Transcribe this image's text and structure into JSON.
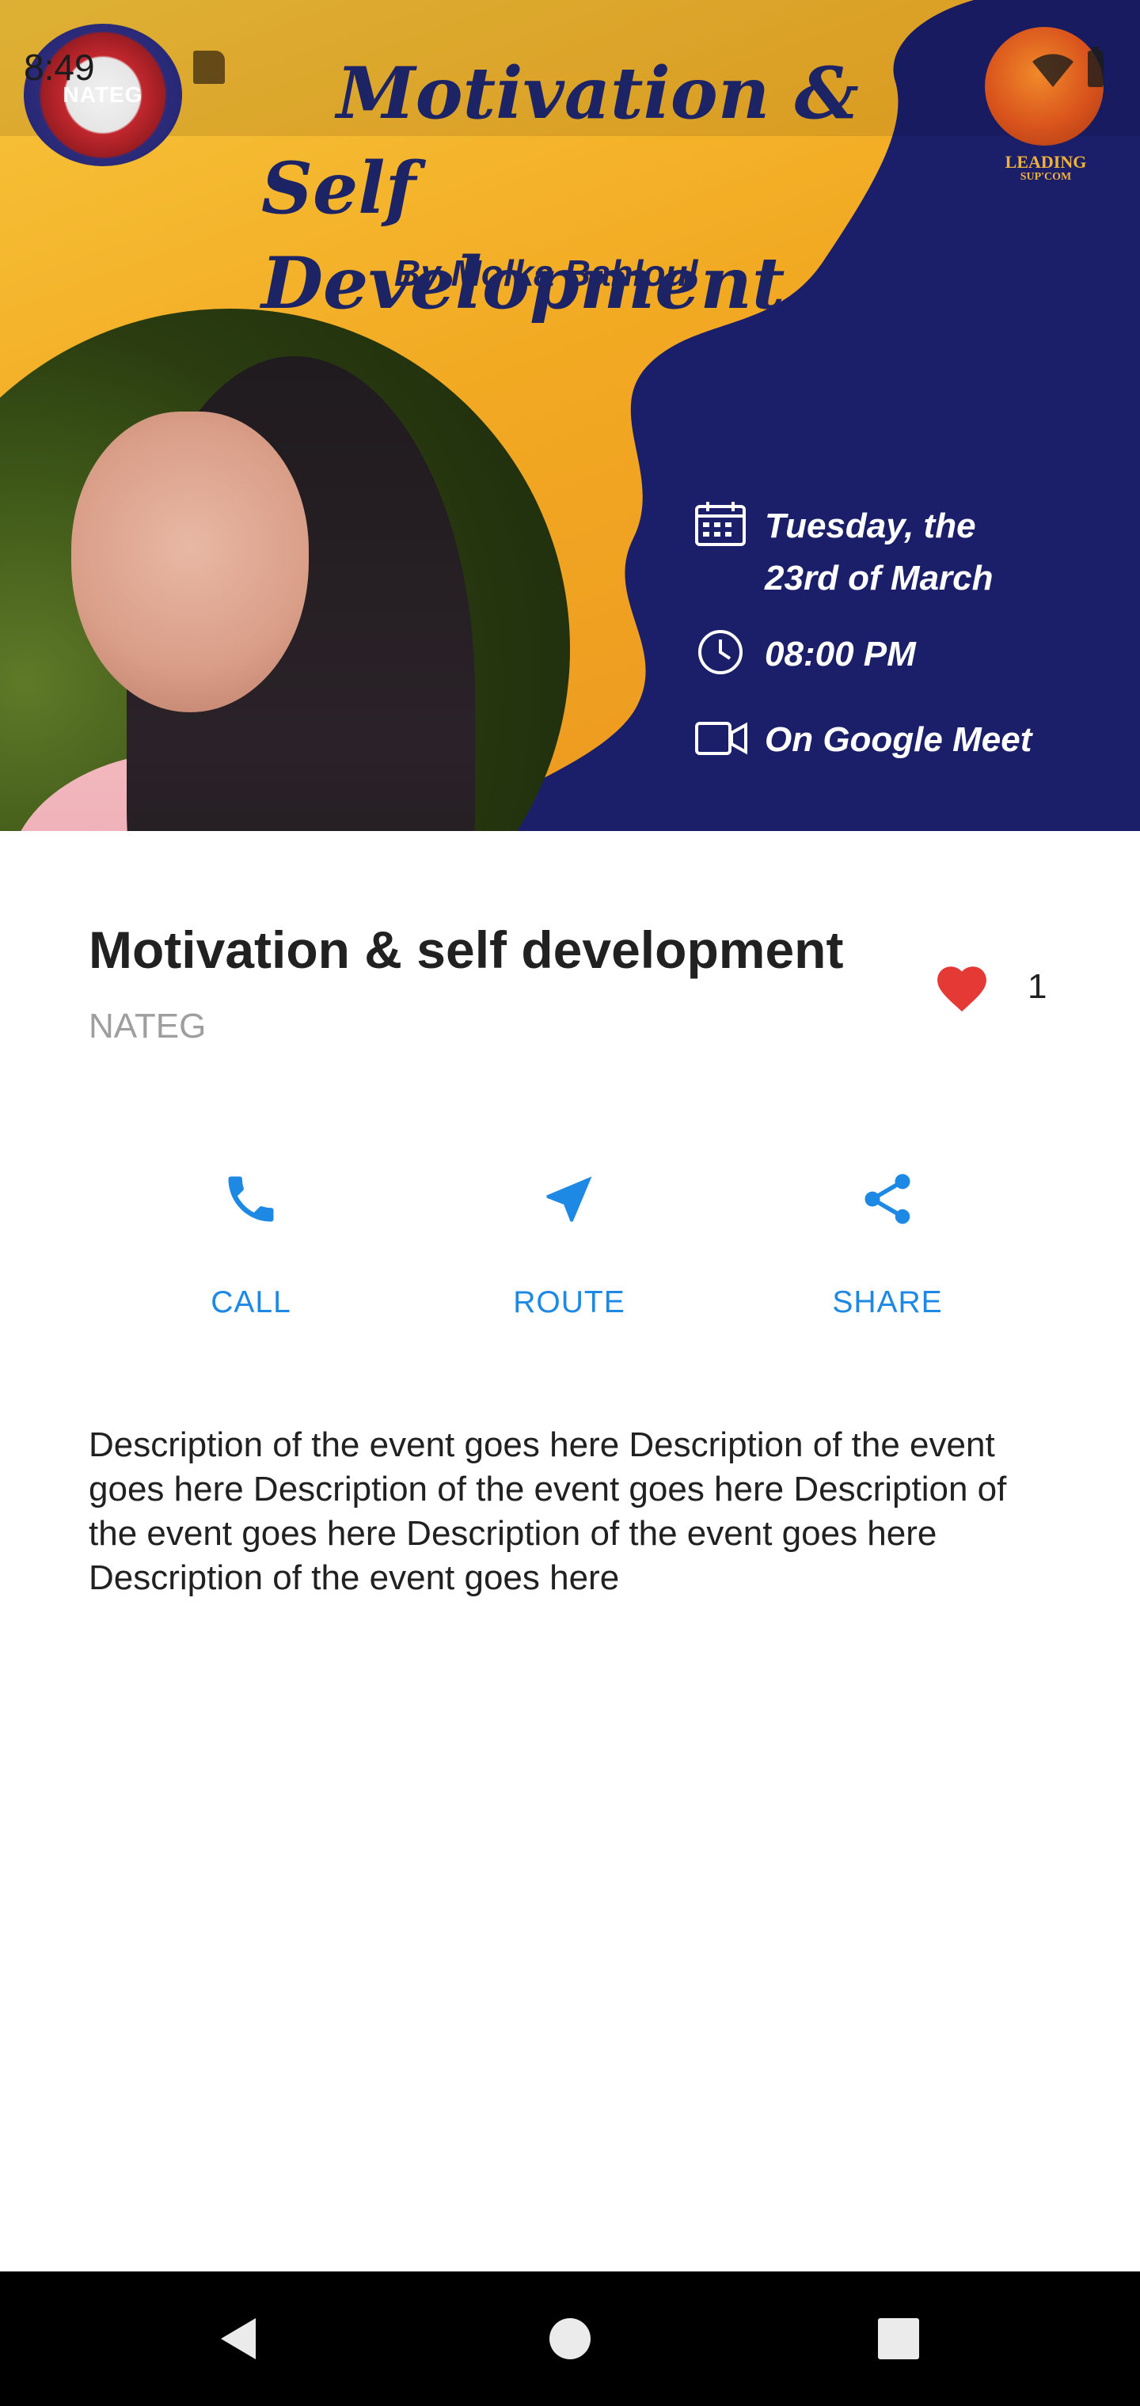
{
  "status_bar": {
    "time": "8:49",
    "icons": [
      "sd-card-icon",
      "wifi-icon",
      "battery-icon"
    ]
  },
  "banner": {
    "logo_left_text": "NATEG",
    "logo_right_text": "LEADING",
    "logo_right_subtext": "SUP'COM",
    "title_line1": "Motivation &",
    "title_line2": "Self Development",
    "byline": "By Molka Bahloul",
    "date_line1": "Tuesday, the",
    "date_line2": "23rd of March",
    "time": "08:00 PM",
    "platform": "On Google Meet",
    "colors": {
      "yellow": "#f2a922",
      "navy": "#1b1f6a"
    }
  },
  "event": {
    "title": "Motivation & self development",
    "organizer": "NATEG",
    "likes": "1"
  },
  "actions": [
    {
      "label": "CALL",
      "icon": "phone-icon"
    },
    {
      "label": "ROUTE",
      "icon": "navigation-arrow-icon"
    },
    {
      "label": "SHARE",
      "icon": "share-icon"
    }
  ],
  "description": "Description of the event goes here Description of the event goes here Description of the event goes here Description of the event goes here Description of the event goes here Description of the event goes here",
  "nav_bar": {
    "buttons": [
      "back-icon",
      "home-icon",
      "recents-icon"
    ]
  },
  "theme": {
    "accent": "#1e88e5",
    "like": "#e53935",
    "title_text": "#212121",
    "secondary_text": "#9e9e9e"
  }
}
